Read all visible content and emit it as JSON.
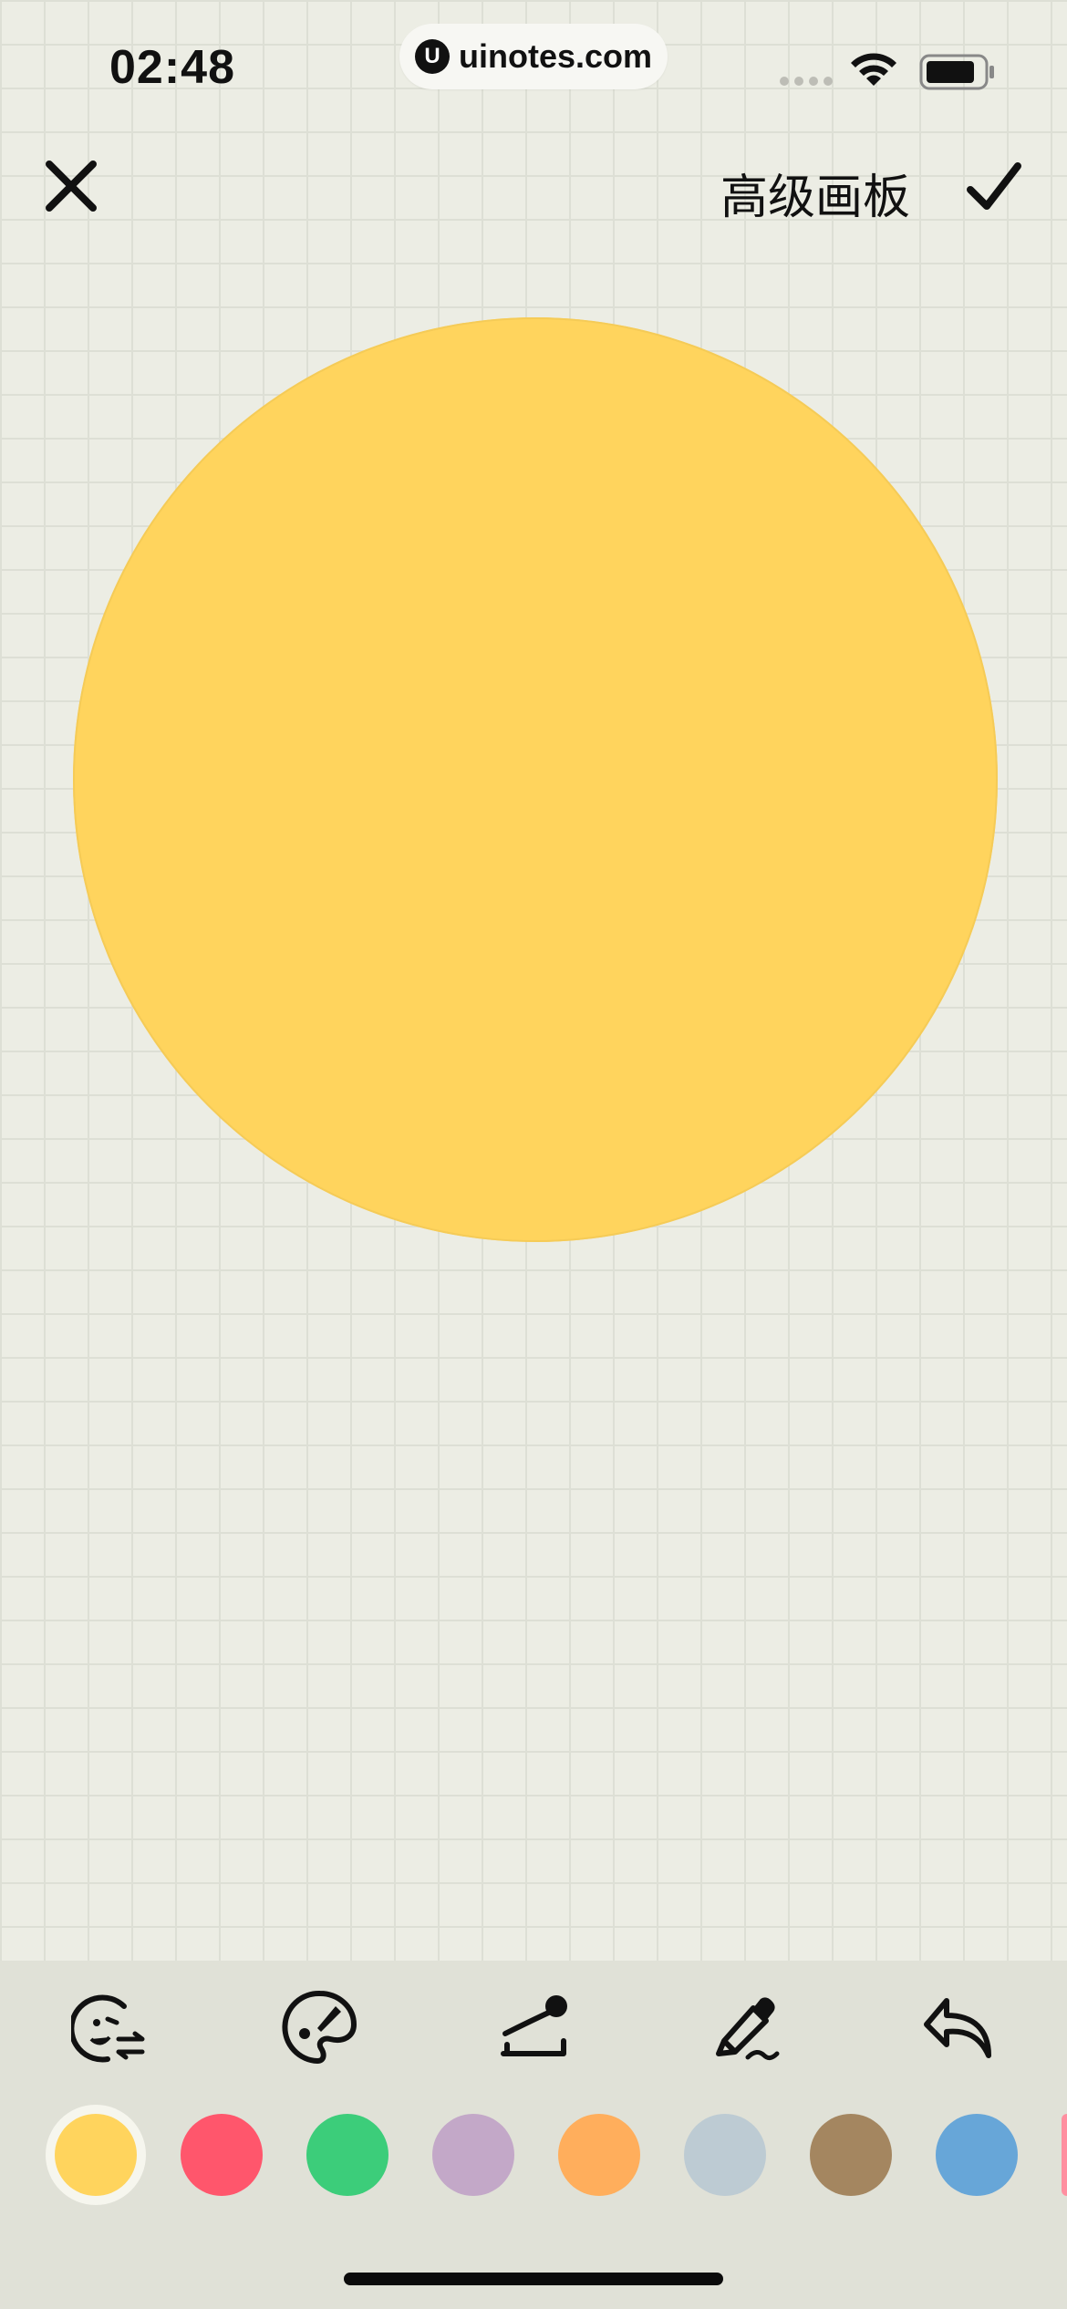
{
  "status_bar": {
    "time": "02:48",
    "url": "uinotes.com",
    "url_logo": "U"
  },
  "header": {
    "title": "高级画板",
    "close_icon": "close-icon",
    "confirm_icon": "check-icon"
  },
  "canvas": {
    "shape": "circle",
    "fill_color": "#ffd45d"
  },
  "toolbar": {
    "tools": [
      "swap-emoji-icon",
      "palette-icon",
      "brush-size-icon",
      "marker-pen-icon",
      "undo-icon"
    ],
    "colors": [
      "#ffd45d",
      "#ff566c",
      "#3ccd7a",
      "#c3a8c8",
      "#ffae5c",
      "#bdcbd3",
      "#a48660",
      "#67a6d8",
      "#ff8fa0"
    ],
    "selected_color_index": 0
  }
}
